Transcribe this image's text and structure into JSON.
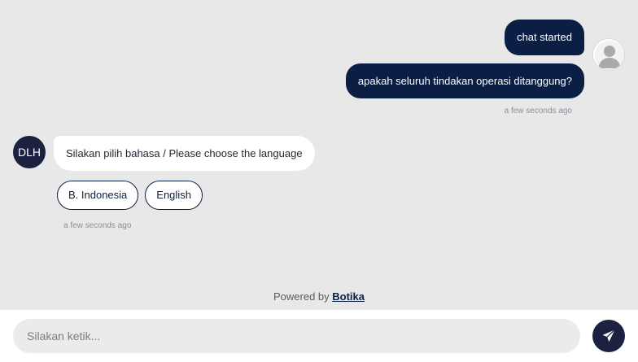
{
  "messages": {
    "user": [
      {
        "text": "chat started"
      },
      {
        "text": "apakah seluruh tindakan operasi ditanggung?"
      }
    ],
    "user_timestamp": "a few seconds ago",
    "bot": {
      "avatar_initials": "DLH",
      "text": "Silakan pilih bahasa / Please choose the language",
      "quick_replies": [
        "B. Indonesia",
        "English"
      ],
      "timestamp": "a few seconds ago"
    }
  },
  "footer": {
    "powered_prefix": "Powered by",
    "powered_brand": "Botika",
    "input_placeholder": "Silakan ketik..."
  },
  "icons": {
    "send": "paper-plane-icon",
    "user_avatar": "person-silhouette-icon"
  },
  "colors": {
    "accent": "#0b1f45",
    "bot_avatar": "#1c2140",
    "background": "#e8e8e8"
  }
}
